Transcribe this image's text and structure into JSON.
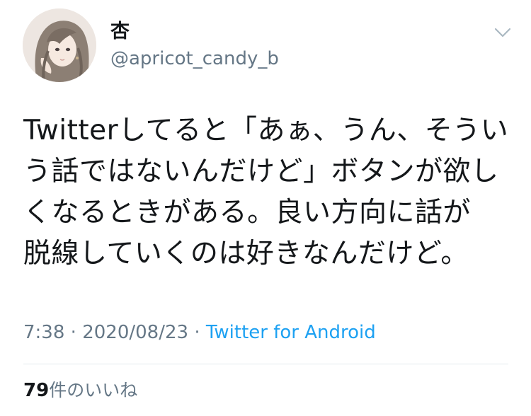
{
  "tweet": {
    "author": {
      "display_name": "杏",
      "handle": "@apricot_candy_b"
    },
    "text_lines": [
      "Twitterしてると「あぁ、うん、そうい",
      "う話ではないんだけど」ボタンが欲し",
      "くなるときがある。良い方向に話が",
      "脱線していくのは好きなんだけど。"
    ],
    "time": "7:38",
    "separator": "·",
    "date": "2020/08/23",
    "source": "Twitter for Android",
    "likes": {
      "count": "79",
      "label": "件のいいね"
    },
    "icons": {
      "menu": "chevron-down-icon",
      "avatar": "avatar-illustration"
    },
    "colors": {
      "text": "#14171a",
      "secondary": "#657786",
      "link": "#1da1f2",
      "divider": "#e1e8ed"
    }
  }
}
